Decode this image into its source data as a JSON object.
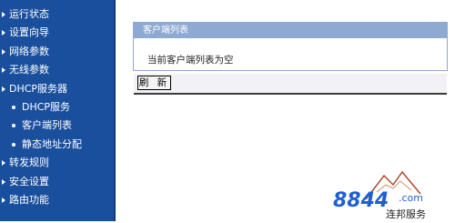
{
  "sidebar": {
    "items": [
      {
        "label": "运行状态",
        "type": "top"
      },
      {
        "label": "设置向导",
        "type": "top"
      },
      {
        "label": "网络参数",
        "type": "top"
      },
      {
        "label": "无线参数",
        "type": "top"
      },
      {
        "label": "DHCP服务器",
        "type": "top"
      },
      {
        "label": "DHCP服务",
        "type": "sub"
      },
      {
        "label": "客户端列表",
        "type": "sub"
      },
      {
        "label": "静态地址分配",
        "type": "sub"
      },
      {
        "label": "转发规则",
        "type": "top"
      },
      {
        "label": "安全设置",
        "type": "top"
      },
      {
        "label": "路由功能",
        "type": "top"
      }
    ]
  },
  "panel": {
    "title": "客户端列表",
    "message": "当前客户端列表为空"
  },
  "actions": {
    "refresh_label": "刷 新"
  },
  "watermark": {
    "brand": "8844",
    "domain": ".com",
    "tagline": "连邦服务"
  },
  "colors": {
    "sidebar_bg": "#1a4f9e",
    "panel_header_bg": "#8eaad3",
    "panel_border": "#8fa9cf",
    "watermark_brand": "#1f5fd0"
  }
}
